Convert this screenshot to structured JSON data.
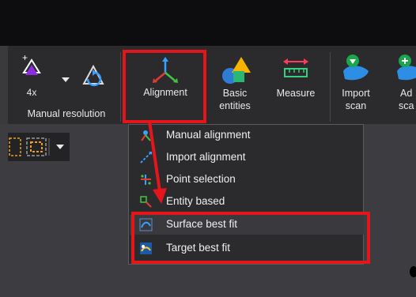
{
  "ribbon": {
    "resolution_value": "4x",
    "group_label": "Manual resolution",
    "alignment_label": "Alignment",
    "basic_entities_label": [
      "Basic",
      "entities"
    ],
    "measure_label": "Measure",
    "import_scan_label": [
      "Import",
      "scan"
    ],
    "add_scan_label": [
      "Ad",
      "sca"
    ]
  },
  "menu": {
    "items": [
      {
        "label": "Manual alignment",
        "icon": "manual-alignment-icon"
      },
      {
        "label": "Import alignment",
        "icon": "import-alignment-icon"
      },
      {
        "label": "Point selection",
        "icon": "point-selection-icon"
      },
      {
        "label": "Entity based",
        "icon": "entity-based-icon"
      },
      {
        "label": "Surface best fit",
        "icon": "surface-best-fit-icon"
      },
      {
        "label": "Target best fit",
        "icon": "target-best-fit-icon"
      }
    ]
  },
  "colors": {
    "annotation_red": "#e4161c",
    "ribbon_bg": "#2b2b2e",
    "viewport_bg": "#3d3d41"
  }
}
